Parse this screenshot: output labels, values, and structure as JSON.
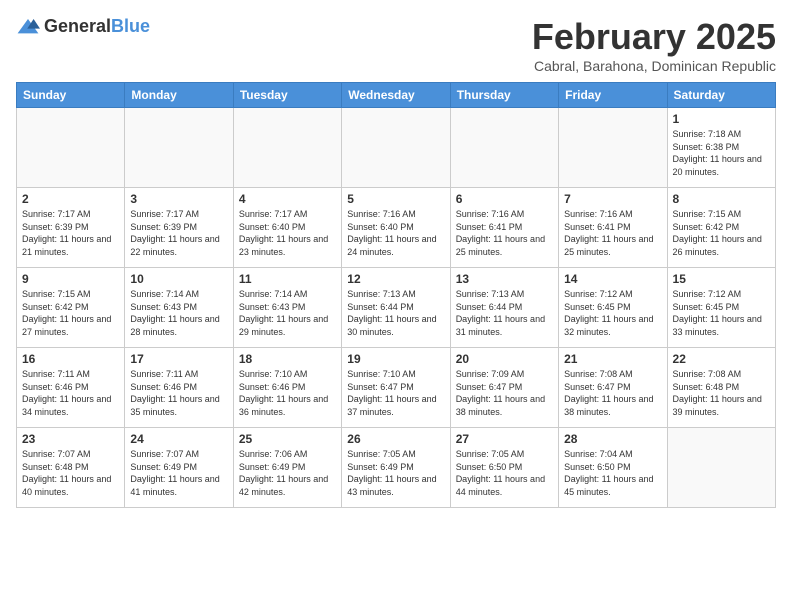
{
  "header": {
    "logo_general": "General",
    "logo_blue": "Blue",
    "month_year": "February 2025",
    "location": "Cabral, Barahona, Dominican Republic"
  },
  "weekdays": [
    "Sunday",
    "Monday",
    "Tuesday",
    "Wednesday",
    "Thursday",
    "Friday",
    "Saturday"
  ],
  "weeks": [
    [
      {
        "day": "",
        "info": ""
      },
      {
        "day": "",
        "info": ""
      },
      {
        "day": "",
        "info": ""
      },
      {
        "day": "",
        "info": ""
      },
      {
        "day": "",
        "info": ""
      },
      {
        "day": "",
        "info": ""
      },
      {
        "day": "1",
        "info": "Sunrise: 7:18 AM\nSunset: 6:38 PM\nDaylight: 11 hours and 20 minutes."
      }
    ],
    [
      {
        "day": "2",
        "info": "Sunrise: 7:17 AM\nSunset: 6:39 PM\nDaylight: 11 hours and 21 minutes."
      },
      {
        "day": "3",
        "info": "Sunrise: 7:17 AM\nSunset: 6:39 PM\nDaylight: 11 hours and 22 minutes."
      },
      {
        "day": "4",
        "info": "Sunrise: 7:17 AM\nSunset: 6:40 PM\nDaylight: 11 hours and 23 minutes."
      },
      {
        "day": "5",
        "info": "Sunrise: 7:16 AM\nSunset: 6:40 PM\nDaylight: 11 hours and 24 minutes."
      },
      {
        "day": "6",
        "info": "Sunrise: 7:16 AM\nSunset: 6:41 PM\nDaylight: 11 hours and 25 minutes."
      },
      {
        "day": "7",
        "info": "Sunrise: 7:16 AM\nSunset: 6:41 PM\nDaylight: 11 hours and 25 minutes."
      },
      {
        "day": "8",
        "info": "Sunrise: 7:15 AM\nSunset: 6:42 PM\nDaylight: 11 hours and 26 minutes."
      }
    ],
    [
      {
        "day": "9",
        "info": "Sunrise: 7:15 AM\nSunset: 6:42 PM\nDaylight: 11 hours and 27 minutes."
      },
      {
        "day": "10",
        "info": "Sunrise: 7:14 AM\nSunset: 6:43 PM\nDaylight: 11 hours and 28 minutes."
      },
      {
        "day": "11",
        "info": "Sunrise: 7:14 AM\nSunset: 6:43 PM\nDaylight: 11 hours and 29 minutes."
      },
      {
        "day": "12",
        "info": "Sunrise: 7:13 AM\nSunset: 6:44 PM\nDaylight: 11 hours and 30 minutes."
      },
      {
        "day": "13",
        "info": "Sunrise: 7:13 AM\nSunset: 6:44 PM\nDaylight: 11 hours and 31 minutes."
      },
      {
        "day": "14",
        "info": "Sunrise: 7:12 AM\nSunset: 6:45 PM\nDaylight: 11 hours and 32 minutes."
      },
      {
        "day": "15",
        "info": "Sunrise: 7:12 AM\nSunset: 6:45 PM\nDaylight: 11 hours and 33 minutes."
      }
    ],
    [
      {
        "day": "16",
        "info": "Sunrise: 7:11 AM\nSunset: 6:46 PM\nDaylight: 11 hours and 34 minutes."
      },
      {
        "day": "17",
        "info": "Sunrise: 7:11 AM\nSunset: 6:46 PM\nDaylight: 11 hours and 35 minutes."
      },
      {
        "day": "18",
        "info": "Sunrise: 7:10 AM\nSunset: 6:46 PM\nDaylight: 11 hours and 36 minutes."
      },
      {
        "day": "19",
        "info": "Sunrise: 7:10 AM\nSunset: 6:47 PM\nDaylight: 11 hours and 37 minutes."
      },
      {
        "day": "20",
        "info": "Sunrise: 7:09 AM\nSunset: 6:47 PM\nDaylight: 11 hours and 38 minutes."
      },
      {
        "day": "21",
        "info": "Sunrise: 7:08 AM\nSunset: 6:47 PM\nDaylight: 11 hours and 38 minutes."
      },
      {
        "day": "22",
        "info": "Sunrise: 7:08 AM\nSunset: 6:48 PM\nDaylight: 11 hours and 39 minutes."
      }
    ],
    [
      {
        "day": "23",
        "info": "Sunrise: 7:07 AM\nSunset: 6:48 PM\nDaylight: 11 hours and 40 minutes."
      },
      {
        "day": "24",
        "info": "Sunrise: 7:07 AM\nSunset: 6:49 PM\nDaylight: 11 hours and 41 minutes."
      },
      {
        "day": "25",
        "info": "Sunrise: 7:06 AM\nSunset: 6:49 PM\nDaylight: 11 hours and 42 minutes."
      },
      {
        "day": "26",
        "info": "Sunrise: 7:05 AM\nSunset: 6:49 PM\nDaylight: 11 hours and 43 minutes."
      },
      {
        "day": "27",
        "info": "Sunrise: 7:05 AM\nSunset: 6:50 PM\nDaylight: 11 hours and 44 minutes."
      },
      {
        "day": "28",
        "info": "Sunrise: 7:04 AM\nSunset: 6:50 PM\nDaylight: 11 hours and 45 minutes."
      },
      {
        "day": "",
        "info": ""
      }
    ]
  ]
}
